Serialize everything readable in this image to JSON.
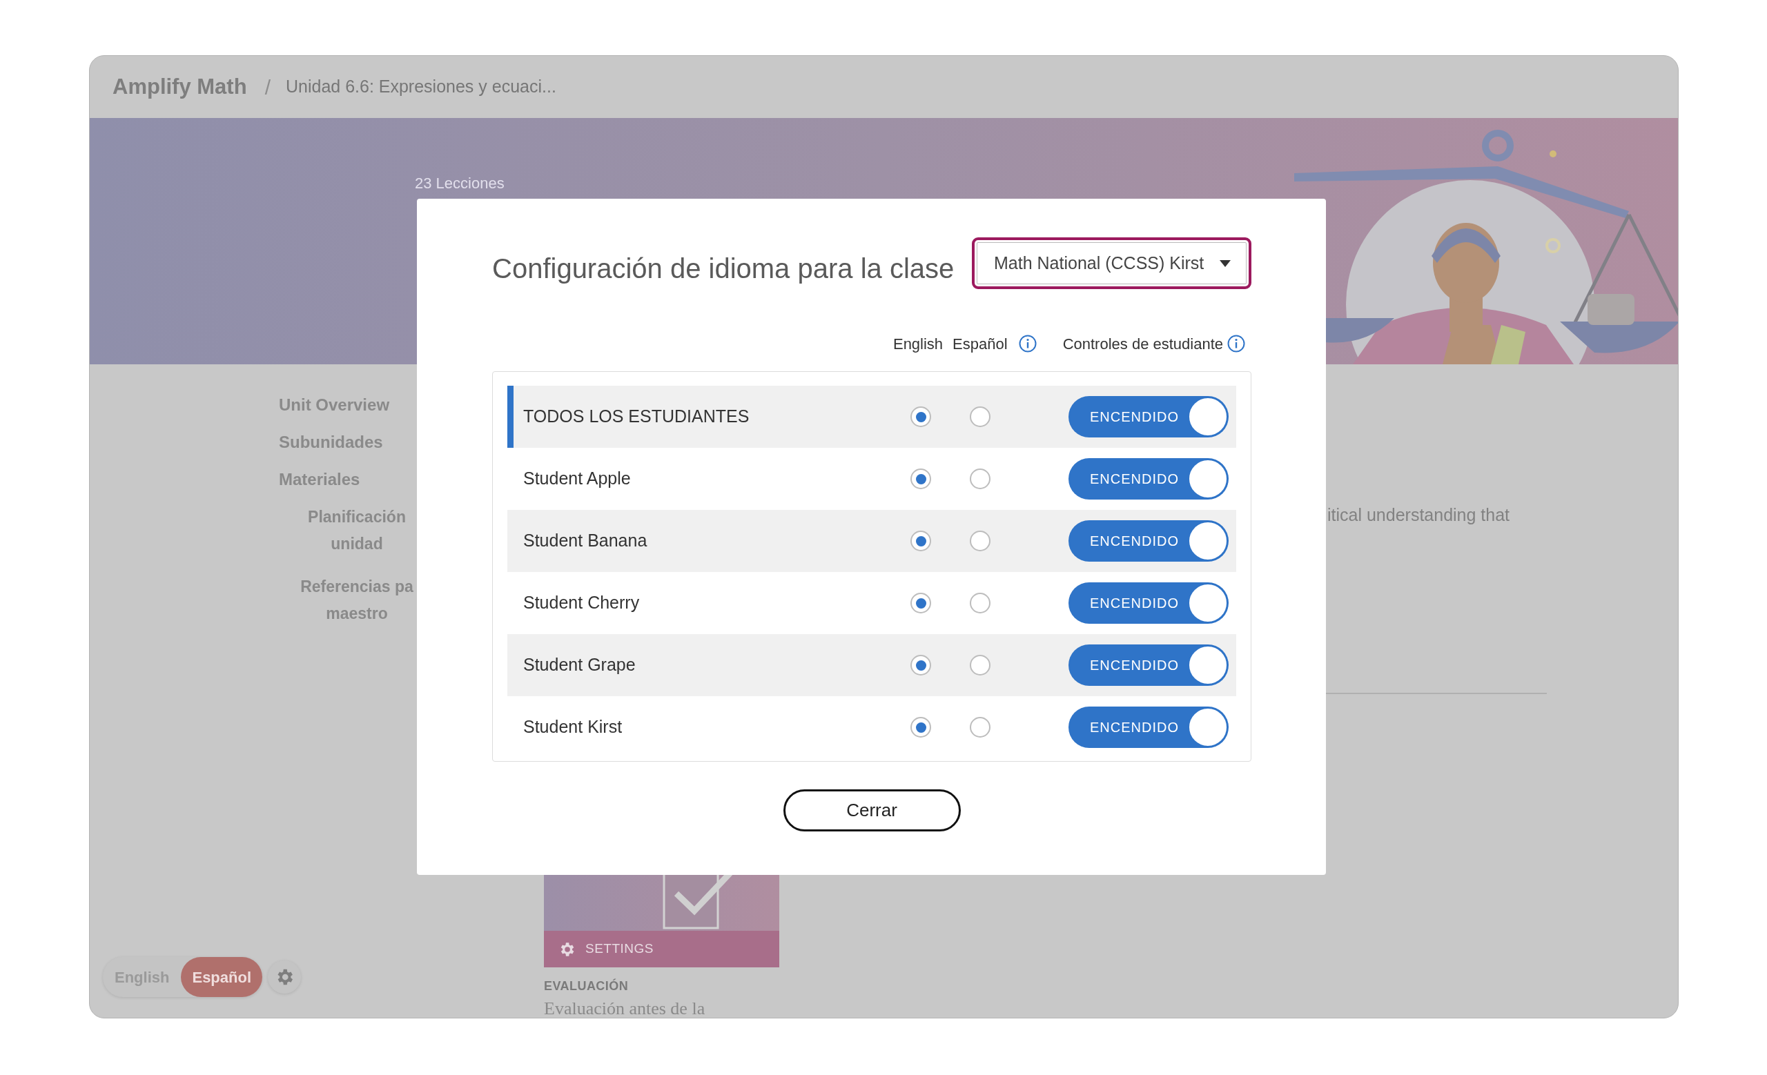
{
  "breadcrumb": {
    "app": "Amplify Math",
    "separator": "/",
    "current": "Unidad 6.6: Expresiones y ecuaci..."
  },
  "banner": {
    "kind": "picture",
    "lesson_count": "23 Lecciones"
  },
  "nav": [
    {
      "lines": [
        "Unit Overview"
      ],
      "sub": false
    },
    {
      "lines": [
        "Subunidades"
      ],
      "sub": false
    },
    {
      "lines": [
        "Materiales"
      ],
      "sub": false
    },
    {
      "lines": [
        "Planificación",
        "unidad"
      ],
      "sub": true
    },
    {
      "lines": [
        "Referencias pa",
        "maestro"
      ],
      "sub": true
    }
  ],
  "description_fragment": "itical understanding that",
  "card": {
    "kind": "picture",
    "action": "SETTINGS",
    "category": "EVALUACIÓN",
    "title": "Evaluación antes de la"
  },
  "language_switch": [
    {
      "label": "English",
      "selected": false
    },
    {
      "label": "Español",
      "selected": true
    }
  ],
  "modal": {
    "title": "Configuración de idioma para la clase",
    "class_select": "Math National (CCSS) Kirst",
    "headers": {
      "english": "English",
      "spanish": "Español",
      "controls": "Controles de estudiante"
    },
    "rows": [
      {
        "kind": "all",
        "name": "TODOS LOS ESTUDIANTES",
        "english_selected": true,
        "spanish_selected": false,
        "controls_on": true,
        "controls_label": "ENCENDIDO"
      },
      {
        "kind": "student",
        "name": "Student Apple",
        "english_selected": true,
        "spanish_selected": false,
        "controls_on": true,
        "controls_label": "ENCENDIDO"
      },
      {
        "kind": "student",
        "name": "Student Banana",
        "english_selected": true,
        "spanish_selected": false,
        "controls_on": true,
        "controls_label": "ENCENDIDO"
      },
      {
        "kind": "student",
        "name": "Student Cherry",
        "english_selected": true,
        "spanish_selected": false,
        "controls_on": true,
        "controls_label": "ENCENDIDO"
      },
      {
        "kind": "student",
        "name": "Student Grape",
        "english_selected": true,
        "spanish_selected": false,
        "controls_on": true,
        "controls_label": "ENCENDIDO"
      },
      {
        "kind": "student",
        "name": "Student Kirst",
        "english_selected": true,
        "spanish_selected": false,
        "controls_on": true,
        "controls_label": "ENCENDIDO"
      }
    ],
    "close": "Cerrar"
  }
}
